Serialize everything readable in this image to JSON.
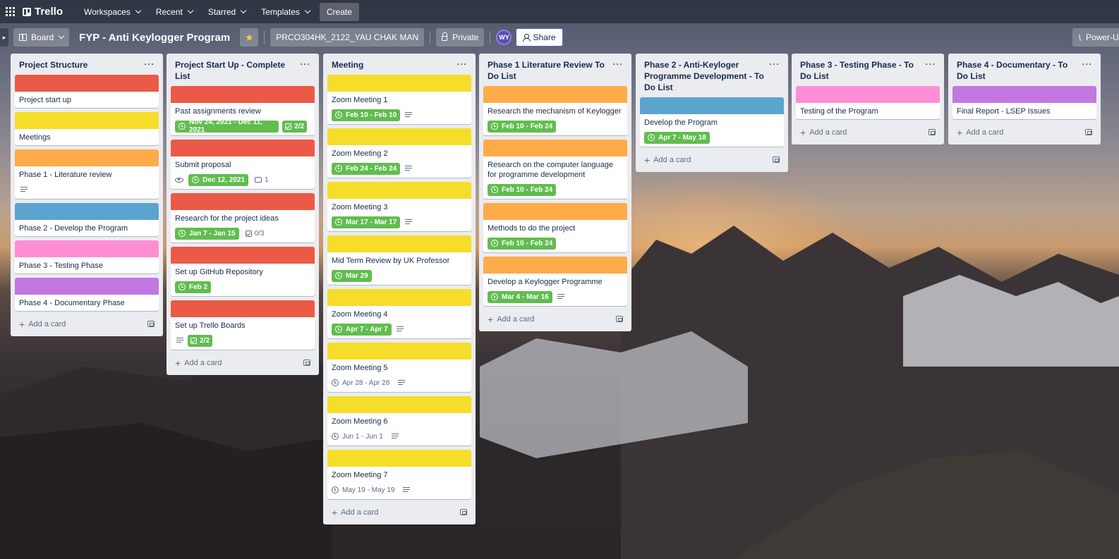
{
  "nav": {
    "brand": "Trello",
    "workspaces": "Workspaces",
    "recent": "Recent",
    "starred": "Starred",
    "templates": "Templates",
    "create": "Create"
  },
  "board": {
    "view": "Board",
    "title": "FYP - Anti Keylogger Program",
    "workspace": "PRCO304HK_2122_YAU CHAK MAN",
    "visibility": "Private",
    "avatar": "WY",
    "share": "Share",
    "power_ups": "Power-Ups"
  },
  "ui": {
    "add_card": "Add a card",
    "list_menu": "···"
  },
  "colors": {
    "red": "#eb5a46",
    "yellow": "#f5dd29",
    "orange": "#ffab4a",
    "blue": "#5ba4cf",
    "pink": "#ff8ed4",
    "purple": "#c377e0",
    "green": "#61bd4f"
  },
  "lists": [
    {
      "title": "Project Structure",
      "cards": [
        {
          "cover": "red",
          "title": "Project start up"
        },
        {
          "cover": "yellow",
          "title": "Meetings"
        },
        {
          "cover": "orange",
          "title": "Phase 1 - Literature review",
          "description": true
        },
        {
          "cover": "blue",
          "title": "Phase 2 - Develop the Program"
        },
        {
          "cover": "pink",
          "title": "Phase 3 - Testing Phase"
        },
        {
          "cover": "purple",
          "title": "Phase 4 - Documentary Phase"
        }
      ]
    },
    {
      "title": "Project Start Up - Complete List",
      "cards": [
        {
          "cover": "red",
          "title": "Past assignments review",
          "due": "Nov 24, 2021 - Dec 11, 2021",
          "due_style": "green",
          "checklist": "2/2",
          "checklist_style": "green"
        },
        {
          "cover": "red",
          "title": "Submit proposal",
          "watch": true,
          "due": "Dec 12, 2021",
          "due_style": "green",
          "comments": "1"
        },
        {
          "cover": "red",
          "title": "Research for the project ideas",
          "due": "Jan 7 - Jan 15",
          "due_style": "green",
          "checklist": "0/3",
          "checklist_style": "plain"
        },
        {
          "cover": "red",
          "title": "Set up GitHub Repository",
          "due": "Feb 2",
          "due_style": "green"
        },
        {
          "cover": "red",
          "title": "Set up Trello Boards",
          "description_first": true,
          "checklist": "2/2",
          "checklist_style": "green"
        }
      ]
    },
    {
      "title": "Meeting",
      "cards": [
        {
          "cover": "yellow",
          "title": "Zoom Meeting 1",
          "due": "Feb 10 - Feb 10",
          "due_style": "green",
          "description": true
        },
        {
          "cover": "yellow",
          "title": "Zoom Meeting 2",
          "due": "Feb 24 - Feb 24",
          "due_style": "green",
          "description": true
        },
        {
          "cover": "yellow",
          "title": "Zoom Meeting 3",
          "due": "Mar 17 - Mar 17",
          "due_style": "green",
          "description": true
        },
        {
          "cover": "yellow",
          "title": "Mid Term Review by UK Professor",
          "due": "Mar 29",
          "due_style": "green"
        },
        {
          "cover": "yellow",
          "title": "Zoom Meeting 4",
          "due": "Apr 7 - Apr 7",
          "due_style": "green",
          "description": true
        },
        {
          "cover": "yellow",
          "title": "Zoom Meeting 5",
          "due": "Apr 28 - Apr 28",
          "due_style": "plain",
          "description": true
        },
        {
          "cover": "yellow",
          "title": "Zoom Meeting 6",
          "due": "Jun 1 - Jun 1",
          "due_style": "plain",
          "description": true
        },
        {
          "cover": "yellow",
          "title": "Zoom Meeting 7",
          "due": "May 19 - May 19",
          "due_style": "plain",
          "description": true
        }
      ]
    },
    {
      "title": "Phase 1 Literature Review To Do List",
      "cards": [
        {
          "cover": "orange",
          "title": "Research the mechanism of Keylogger",
          "due": "Feb 10 - Feb 24",
          "due_style": "green"
        },
        {
          "cover": "orange",
          "title": "Research on the computer language for programme development",
          "due": "Feb 10 - Feb 24",
          "due_style": "green"
        },
        {
          "cover": "orange",
          "title": "Methods to do the project",
          "due": "Feb 10 - Feb 24",
          "due_style": "green"
        },
        {
          "cover": "orange",
          "title": "Develop a Keylogger Programme",
          "due": "Mar 4 - Mar 16",
          "due_style": "green",
          "description": true
        }
      ]
    },
    {
      "title": "Phase 2 - Anti-Keyloger Programme Development - To Do List",
      "cards": [
        {
          "cover": "blue",
          "title": "Develop the Program",
          "due": "Apr 7 - May 18",
          "due_style": "green"
        }
      ]
    },
    {
      "title": "Phase 3 - Testing Phase - To Do List",
      "cards": [
        {
          "cover": "pink",
          "title": "Testing of the Program"
        }
      ]
    },
    {
      "title": "Phase 4 - Documentary - To Do List",
      "cards": [
        {
          "cover": "purple",
          "title": "Final Report - LSEP Issues"
        }
      ]
    }
  ]
}
